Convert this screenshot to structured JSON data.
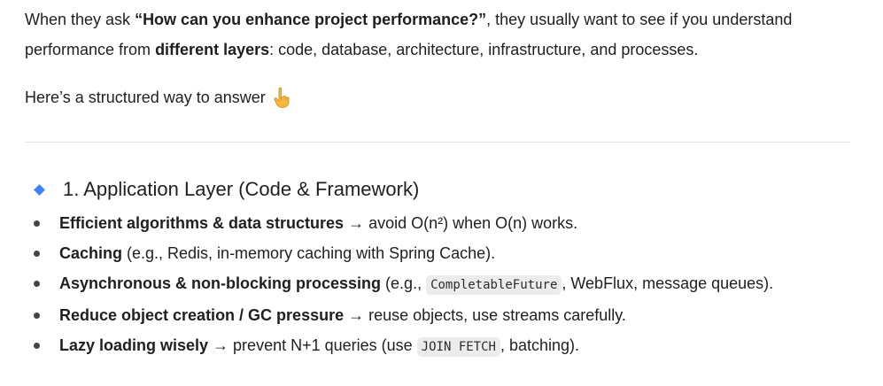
{
  "intro": {
    "prefix": "When they ask ",
    "question": "“How can you enhance project performance?”",
    "middle": ", they usually want to see if you understand performance from ",
    "bold": "different layers",
    "suffix": ": code, database, architecture, infrastructure, and processes."
  },
  "lead": {
    "text": "Here’s a structured way to answer",
    "icon": "pointing-down-hand-icon"
  },
  "section": {
    "marker_color": "#3b82f6",
    "title": "1. Application Layer (Code & Framework)",
    "items": [
      {
        "bold": "Efficient algorithms & data structures",
        "rest": " → avoid O(n²) when O(n) works."
      },
      {
        "bold": "Caching",
        "rest": " (e.g., Redis, in-memory caching with Spring Cache)."
      },
      {
        "bold": "Asynchronous & non-blocking processing",
        "pre_code": " (e.g., ",
        "code": "CompletableFuture",
        "post_code": ", WebFlux, message queues)."
      },
      {
        "bold": "Reduce object creation / GC pressure",
        "rest": " → reuse objects, use streams carefully."
      },
      {
        "bold": "Lazy loading wisely",
        "pre_code": " → prevent N+1 queries (use ",
        "code": "JOIN FETCH",
        "post_code": ", batching)."
      }
    ]
  }
}
